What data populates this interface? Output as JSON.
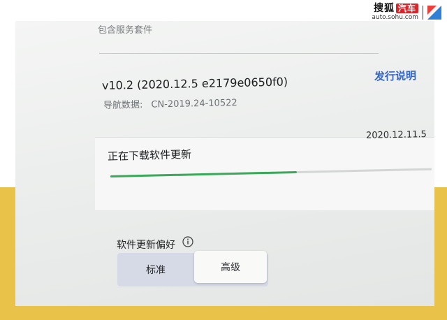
{
  "watermark": {
    "brand_cn": "搜狐",
    "brand_tag": "汽车",
    "url": "auto.sohu.com"
  },
  "package": {
    "included_label": "包含服务套件"
  },
  "software": {
    "version": "v10.2 (2020.12.5 e2179e0650f0)",
    "nav_data_label": "导航数据:",
    "nav_data_value": "CN-2019.24-10522",
    "release_notes_label": "发行说明",
    "build_date": "2020.12.11.5"
  },
  "download": {
    "status_label": "正在下载软件更新",
    "progress_fraction": 0.58,
    "progress_color": "#3aa95a"
  },
  "preference": {
    "label": "软件更新偏好",
    "info_icon": "info-icon",
    "options": [
      "标准",
      "高级"
    ],
    "selected": "高级"
  },
  "colors": {
    "accent_link": "#3566c7",
    "background_band": "#e9c24a"
  }
}
